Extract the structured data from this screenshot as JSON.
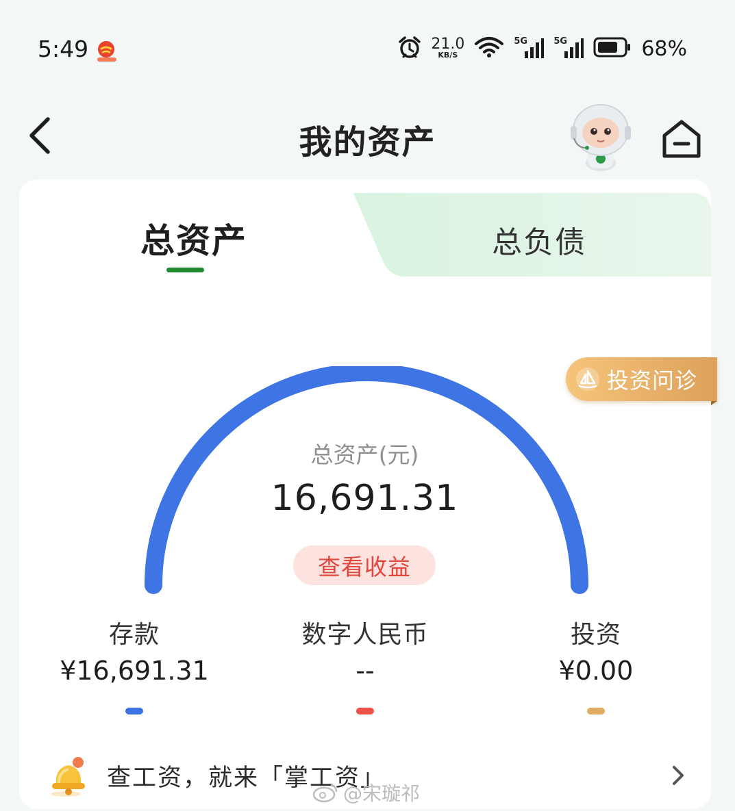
{
  "status_bar": {
    "time": "5:49",
    "net_speed_value": "21.0",
    "net_speed_unit": "KB/S",
    "signal_1": "5G",
    "signal_2": "5G",
    "battery": "68%"
  },
  "header": {
    "title": "我的资产",
    "back_icon": "chevron-left-icon",
    "assistant_icon": "robot-assistant-icon",
    "home_icon": "home-icon"
  },
  "tabs": {
    "assets": "总资产",
    "liabilities": "总负债",
    "active": "assets"
  },
  "badge": {
    "label": "投资问诊",
    "icon": "sailboat-icon"
  },
  "summary": {
    "label": "总资产(元)",
    "value": "16,691.31",
    "earnings_button": "查看收益"
  },
  "categories": [
    {
      "label": "存款",
      "value": "¥16,691.31",
      "color": "#3e74e4"
    },
    {
      "label": "数字人民币",
      "value": "--",
      "color": "#ee5149"
    },
    {
      "label": "投资",
      "value": "¥0.00",
      "color": "#e0ac62"
    }
  ],
  "gauge": {
    "deposit_fraction": 1.0,
    "color": "#3e74e4"
  },
  "banner": {
    "text": "查工资，就来「掌工资」",
    "icon": "bell-icon"
  },
  "watermark": "@宋璇祁"
}
